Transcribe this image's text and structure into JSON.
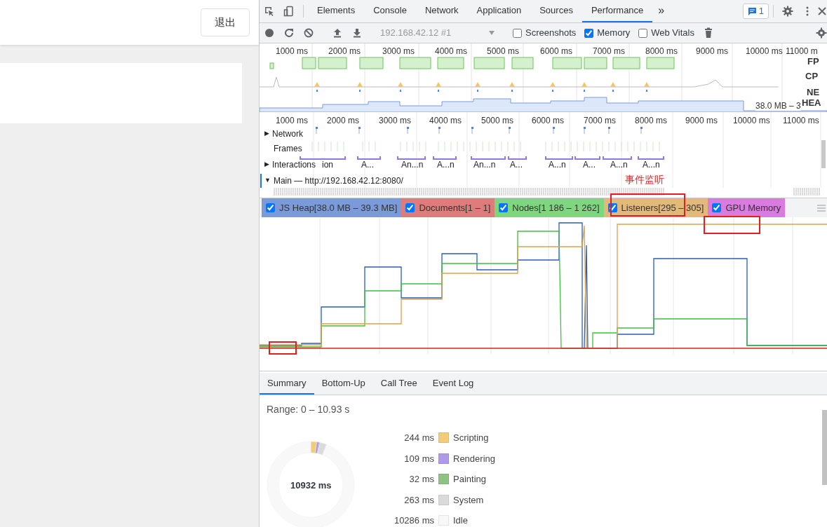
{
  "page": {
    "logout_button": "退出"
  },
  "devtools": {
    "tabs": [
      {
        "label": "Elements",
        "selected": false
      },
      {
        "label": "Console",
        "selected": false
      },
      {
        "label": "Network",
        "selected": false
      },
      {
        "label": "Application",
        "selected": false
      },
      {
        "label": "Sources",
        "selected": false
      },
      {
        "label": "Performance",
        "selected": true
      }
    ],
    "more_tabs": "»",
    "issues_count": "1",
    "toolbar": {
      "recording_select": "192.168.42.12 #1",
      "checkboxes": [
        {
          "label": "Screenshots",
          "checked": false
        },
        {
          "label": "Memory",
          "checked": true
        },
        {
          "label": "Web Vitals",
          "checked": false
        }
      ]
    },
    "overview": {
      "ticks": [
        "1000 ms",
        "2000 ms",
        "3000 ms",
        "4000 ms",
        "5000 ms",
        "6000 ms",
        "7000 ms",
        "8000 ms",
        "9000 ms",
        "10000 ms",
        "11000 m"
      ],
      "track_labels": [
        "FP",
        "CP",
        "NE",
        "HEA"
      ],
      "heap_reading": "38.0 MB – 3"
    },
    "timeline": {
      "ticks": [
        "1000 ms",
        "2000 ms",
        "3000 ms",
        "4000 ms",
        "5000 ms",
        "6000 ms",
        "7000 ms",
        "8000 ms",
        "9000 ms",
        "10000 ms",
        "11000 ms"
      ],
      "tracks": [
        {
          "arrow": "▶",
          "label": "Network"
        },
        {
          "label": "Frames"
        },
        {
          "arrow": "▶",
          "label": "Interactions"
        },
        {
          "arrow": "▼",
          "label": "Main — http://192.168.42.12:8080/"
        }
      ],
      "interactions": [
        "ion",
        "A...",
        "An...n",
        "A...n",
        "An...n",
        "A...",
        "A...n",
        "A...",
        "A...n",
        "A...n"
      ]
    },
    "annotation": "事件监听",
    "counters": [
      {
        "label": "JS Heap[38.0 MB – 39.3 MB]",
        "checked": true,
        "color": "#7a9ad9"
      },
      {
        "label": "Documents[1 – 1]",
        "checked": true,
        "color": "#df7b7b"
      },
      {
        "label": "Nodes[1 186 – 1 262]",
        "checked": true,
        "color": "#7ed77e"
      },
      {
        "label": "Listeners[295 – 305]",
        "checked": true,
        "color": "#e3b97a"
      },
      {
        "label": "GPU Memory",
        "checked": true,
        "color": "#d97bdf"
      }
    ],
    "bottom_tabs": [
      {
        "label": "Summary",
        "selected": true
      },
      {
        "label": "Bottom-Up",
        "selected": false
      },
      {
        "label": "Call Tree",
        "selected": false
      },
      {
        "label": "Event Log",
        "selected": false
      }
    ],
    "summary": {
      "range": "Range: 0 – 10.93 s",
      "total": "10932 ms",
      "categories": [
        {
          "time": "244 ms",
          "label": "Scripting",
          "color": "#f2cc76"
        },
        {
          "time": "109 ms",
          "label": "Rendering",
          "color": "#ae9ae8"
        },
        {
          "time": "32 ms",
          "label": "Painting",
          "color": "#8fc384"
        },
        {
          "time": "263 ms",
          "label": "System",
          "color": "#dadada"
        },
        {
          "time": "10286 ms",
          "label": "Idle",
          "color": "#f8f8f8"
        }
      ]
    }
  }
}
